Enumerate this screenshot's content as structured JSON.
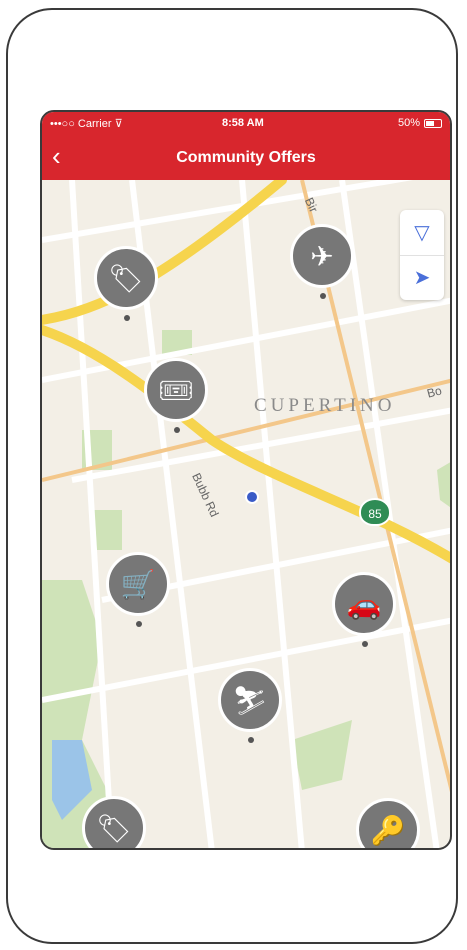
{
  "status_bar": {
    "carrier": "•••○○ Carrier ⊽",
    "time": "8:58 AM",
    "battery": "50%"
  },
  "nav": {
    "back_glyph": "‹",
    "title": "Community Offers"
  },
  "map": {
    "city": "CUPERTINO",
    "streets": [
      "Bubb Rd",
      "Bir",
      "Bo"
    ],
    "highway_shield": "85",
    "controls": {
      "filter_glyph": "▽",
      "locate_glyph": "➤"
    }
  },
  "pins": [
    {
      "name": "clothing-tag-pin",
      "glyph": "🏷"
    },
    {
      "name": "airplane-pin",
      "glyph": "✈"
    },
    {
      "name": "tickets-pin",
      "glyph": "🎟"
    },
    {
      "name": "shopping-cart-pin",
      "glyph": "🛒"
    },
    {
      "name": "car-pin",
      "glyph": "🚗"
    },
    {
      "name": "ski-pin",
      "glyph": "⛷"
    },
    {
      "name": "clothing-tag-pin-2",
      "glyph": "🏷"
    },
    {
      "name": "key-pin",
      "glyph": "🔑"
    }
  ]
}
